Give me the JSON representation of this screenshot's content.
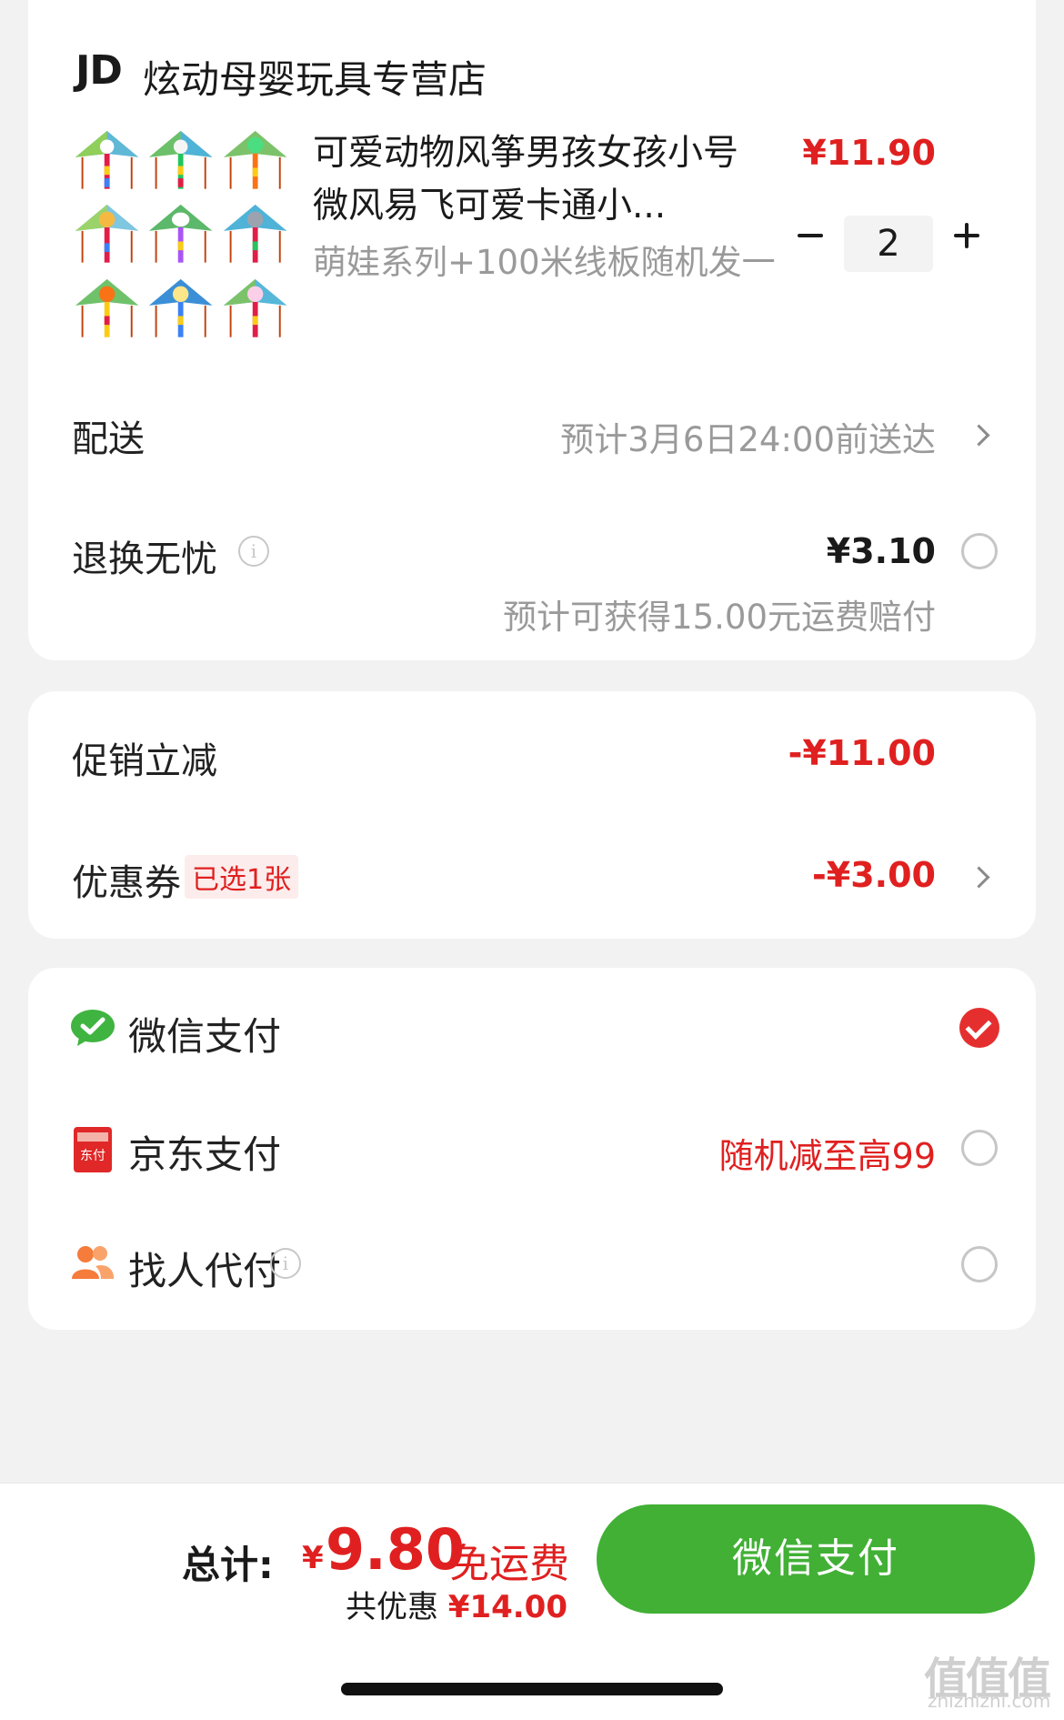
{
  "store": {
    "logo": "JD",
    "name": "炫动母婴玩具专营店"
  },
  "product": {
    "title": "可爱动物风筝男孩女孩小号微风易飞可爱卡通小...",
    "spec": "萌娃系列+100米线板随机发一",
    "price": "¥11.90",
    "quantity": "2"
  },
  "delivery": {
    "label": "配送",
    "value": "预计3月6日24:00前送达"
  },
  "return_insurance": {
    "label": "退换无忧",
    "price": "¥3.10",
    "note": "预计可获得15.00元运费赔付"
  },
  "discounts": {
    "promo_label": "促销立减",
    "promo_value": "-¥11.00",
    "coupon_label": "优惠券",
    "coupon_tag": "已选1张",
    "coupon_value": "-¥3.00"
  },
  "payment": {
    "wechat_label": "微信支付",
    "jd_label": "京东支付",
    "jd_icon_text": "东付",
    "jd_promo": "随机减至高99",
    "friend_label": "找人代付",
    "selected": "wechat"
  },
  "footer": {
    "total_label": "总计:",
    "currency": "¥",
    "total_amount": "9.80",
    "free_shipping": "免运费",
    "saved_label": "共优惠",
    "saved_amount": "¥14.00",
    "pay_button": "微信支付"
  },
  "watermark": {
    "text": "值值值",
    "domain": "zhizhizhi.com"
  },
  "colors": {
    "accent_red": "#e02020",
    "pay_green": "#41b035",
    "background": "#f2f2f2"
  }
}
